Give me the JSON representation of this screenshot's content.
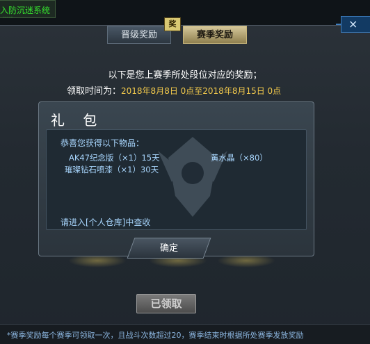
{
  "system_notice": {
    "text": "入防沉迷系统",
    "subtext": "-----"
  },
  "tabs": [
    {
      "label": "晋级奖励",
      "active": false
    },
    {
      "label": "赛季奖励",
      "active": true
    }
  ],
  "tab_badge": "奖",
  "close_icon": "×",
  "headline": "以下是您上赛季所处段位对应的奖励；",
  "claim_time": {
    "label": "领取时间为：",
    "value": "2018年8月8日 0点至2018年8月15日 0点"
  },
  "gift": {
    "title": "礼 包",
    "congrats": "恭喜您获得以下物品：",
    "items": [
      "AK47纪念版（×1）15天",
      "黄水晶（×80）",
      "璀璨钻石喷漆（×1）30天"
    ],
    "warehouse_hint": "请进入[个人仓库]中查收",
    "confirm_label": "确定"
  },
  "claimed_button": "已领取",
  "footer_note": "*赛季奖励每个赛季可领取一次，且战斗次数超过20，赛季结束时根据所处赛季发放奖励",
  "colors": {
    "accent_gold": "#f2c94c",
    "item_text": "#a9d7ff",
    "active_tab": "#c7b57a",
    "notice_green": "#35e12e"
  }
}
